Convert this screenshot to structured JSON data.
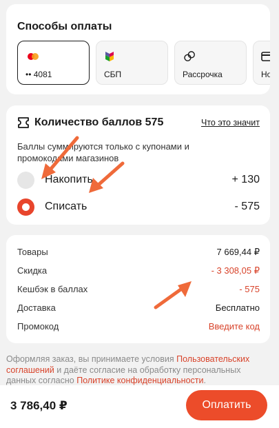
{
  "payment": {
    "title": "Способы оплаты",
    "methods": [
      {
        "label": "•• 4081",
        "icon": "mastercard-icon"
      },
      {
        "label": "СБП",
        "icon": "sbp-icon"
      },
      {
        "label": "Рассрочка",
        "icon": "installment-icon"
      },
      {
        "label": "Нова",
        "icon": "card-icon"
      }
    ]
  },
  "points": {
    "title": "Количество баллов 575",
    "info_link": "Что это значит",
    "note": "Баллы суммируются только с купонами и промокодами магазинов",
    "options": [
      {
        "label": "Накопить",
        "value": "+ 130",
        "selected": false
      },
      {
        "label": "Списать",
        "value": "- 575",
        "selected": true
      }
    ]
  },
  "summary": {
    "rows": [
      {
        "label": "Товары",
        "value": "7 669,44 ₽"
      },
      {
        "label": "Скидка",
        "value": "- 3 308,05 ₽"
      },
      {
        "label": "Кешбэк в баллах",
        "value": "- 575"
      },
      {
        "label": "Доставка",
        "value": "Бесплатно"
      },
      {
        "label": "Промокод",
        "value": "Введите код"
      }
    ]
  },
  "consent": {
    "part1": "Оформляя заказ, вы принимаете условия ",
    "link1": "Пользовательских соглашений",
    "part2": " и даёте согласие на обработку персональных данных согласно ",
    "link2": "Политике конфиденциальности",
    "part3": "."
  },
  "footer": {
    "total": "3 786,40 ₽",
    "pay_label": "Оплатить"
  },
  "colors": {
    "accent": "#ec4c2a",
    "discount_red": "#d8432a",
    "annotation_arrow": "#ef6a3a"
  }
}
